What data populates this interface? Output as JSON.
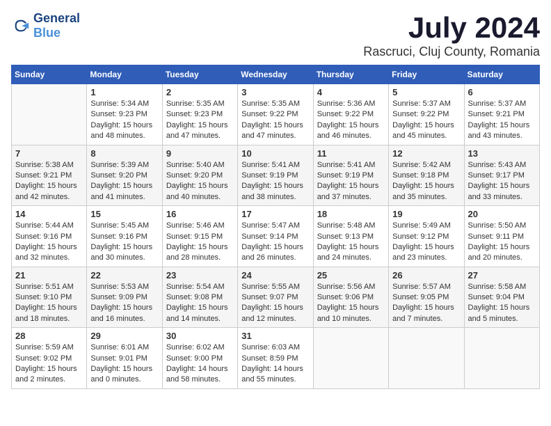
{
  "header": {
    "logo_line1": "General",
    "logo_line2": "Blue",
    "title": "July 2024",
    "subtitle": "Rascruci, Cluj County, Romania"
  },
  "weekdays": [
    "Sunday",
    "Monday",
    "Tuesday",
    "Wednesday",
    "Thursday",
    "Friday",
    "Saturday"
  ],
  "weeks": [
    [
      {
        "day": "",
        "info": ""
      },
      {
        "day": "1",
        "info": "Sunrise: 5:34 AM\nSunset: 9:23 PM\nDaylight: 15 hours\nand 48 minutes."
      },
      {
        "day": "2",
        "info": "Sunrise: 5:35 AM\nSunset: 9:23 PM\nDaylight: 15 hours\nand 47 minutes."
      },
      {
        "day": "3",
        "info": "Sunrise: 5:35 AM\nSunset: 9:22 PM\nDaylight: 15 hours\nand 47 minutes."
      },
      {
        "day": "4",
        "info": "Sunrise: 5:36 AM\nSunset: 9:22 PM\nDaylight: 15 hours\nand 46 minutes."
      },
      {
        "day": "5",
        "info": "Sunrise: 5:37 AM\nSunset: 9:22 PM\nDaylight: 15 hours\nand 45 minutes."
      },
      {
        "day": "6",
        "info": "Sunrise: 5:37 AM\nSunset: 9:21 PM\nDaylight: 15 hours\nand 43 minutes."
      }
    ],
    [
      {
        "day": "7",
        "info": "Sunrise: 5:38 AM\nSunset: 9:21 PM\nDaylight: 15 hours\nand 42 minutes."
      },
      {
        "day": "8",
        "info": "Sunrise: 5:39 AM\nSunset: 9:20 PM\nDaylight: 15 hours\nand 41 minutes."
      },
      {
        "day": "9",
        "info": "Sunrise: 5:40 AM\nSunset: 9:20 PM\nDaylight: 15 hours\nand 40 minutes."
      },
      {
        "day": "10",
        "info": "Sunrise: 5:41 AM\nSunset: 9:19 PM\nDaylight: 15 hours\nand 38 minutes."
      },
      {
        "day": "11",
        "info": "Sunrise: 5:41 AM\nSunset: 9:19 PM\nDaylight: 15 hours\nand 37 minutes."
      },
      {
        "day": "12",
        "info": "Sunrise: 5:42 AM\nSunset: 9:18 PM\nDaylight: 15 hours\nand 35 minutes."
      },
      {
        "day": "13",
        "info": "Sunrise: 5:43 AM\nSunset: 9:17 PM\nDaylight: 15 hours\nand 33 minutes."
      }
    ],
    [
      {
        "day": "14",
        "info": "Sunrise: 5:44 AM\nSunset: 9:16 PM\nDaylight: 15 hours\nand 32 minutes."
      },
      {
        "day": "15",
        "info": "Sunrise: 5:45 AM\nSunset: 9:16 PM\nDaylight: 15 hours\nand 30 minutes."
      },
      {
        "day": "16",
        "info": "Sunrise: 5:46 AM\nSunset: 9:15 PM\nDaylight: 15 hours\nand 28 minutes."
      },
      {
        "day": "17",
        "info": "Sunrise: 5:47 AM\nSunset: 9:14 PM\nDaylight: 15 hours\nand 26 minutes."
      },
      {
        "day": "18",
        "info": "Sunrise: 5:48 AM\nSunset: 9:13 PM\nDaylight: 15 hours\nand 24 minutes."
      },
      {
        "day": "19",
        "info": "Sunrise: 5:49 AM\nSunset: 9:12 PM\nDaylight: 15 hours\nand 23 minutes."
      },
      {
        "day": "20",
        "info": "Sunrise: 5:50 AM\nSunset: 9:11 PM\nDaylight: 15 hours\nand 20 minutes."
      }
    ],
    [
      {
        "day": "21",
        "info": "Sunrise: 5:51 AM\nSunset: 9:10 PM\nDaylight: 15 hours\nand 18 minutes."
      },
      {
        "day": "22",
        "info": "Sunrise: 5:53 AM\nSunset: 9:09 PM\nDaylight: 15 hours\nand 16 minutes."
      },
      {
        "day": "23",
        "info": "Sunrise: 5:54 AM\nSunset: 9:08 PM\nDaylight: 15 hours\nand 14 minutes."
      },
      {
        "day": "24",
        "info": "Sunrise: 5:55 AM\nSunset: 9:07 PM\nDaylight: 15 hours\nand 12 minutes."
      },
      {
        "day": "25",
        "info": "Sunrise: 5:56 AM\nSunset: 9:06 PM\nDaylight: 15 hours\nand 10 minutes."
      },
      {
        "day": "26",
        "info": "Sunrise: 5:57 AM\nSunset: 9:05 PM\nDaylight: 15 hours\nand 7 minutes."
      },
      {
        "day": "27",
        "info": "Sunrise: 5:58 AM\nSunset: 9:04 PM\nDaylight: 15 hours\nand 5 minutes."
      }
    ],
    [
      {
        "day": "28",
        "info": "Sunrise: 5:59 AM\nSunset: 9:02 PM\nDaylight: 15 hours\nand 2 minutes."
      },
      {
        "day": "29",
        "info": "Sunrise: 6:01 AM\nSunset: 9:01 PM\nDaylight: 15 hours\nand 0 minutes."
      },
      {
        "day": "30",
        "info": "Sunrise: 6:02 AM\nSunset: 9:00 PM\nDaylight: 14 hours\nand 58 minutes."
      },
      {
        "day": "31",
        "info": "Sunrise: 6:03 AM\nSunset: 8:59 PM\nDaylight: 14 hours\nand 55 minutes."
      },
      {
        "day": "",
        "info": ""
      },
      {
        "day": "",
        "info": ""
      },
      {
        "day": "",
        "info": ""
      }
    ]
  ]
}
